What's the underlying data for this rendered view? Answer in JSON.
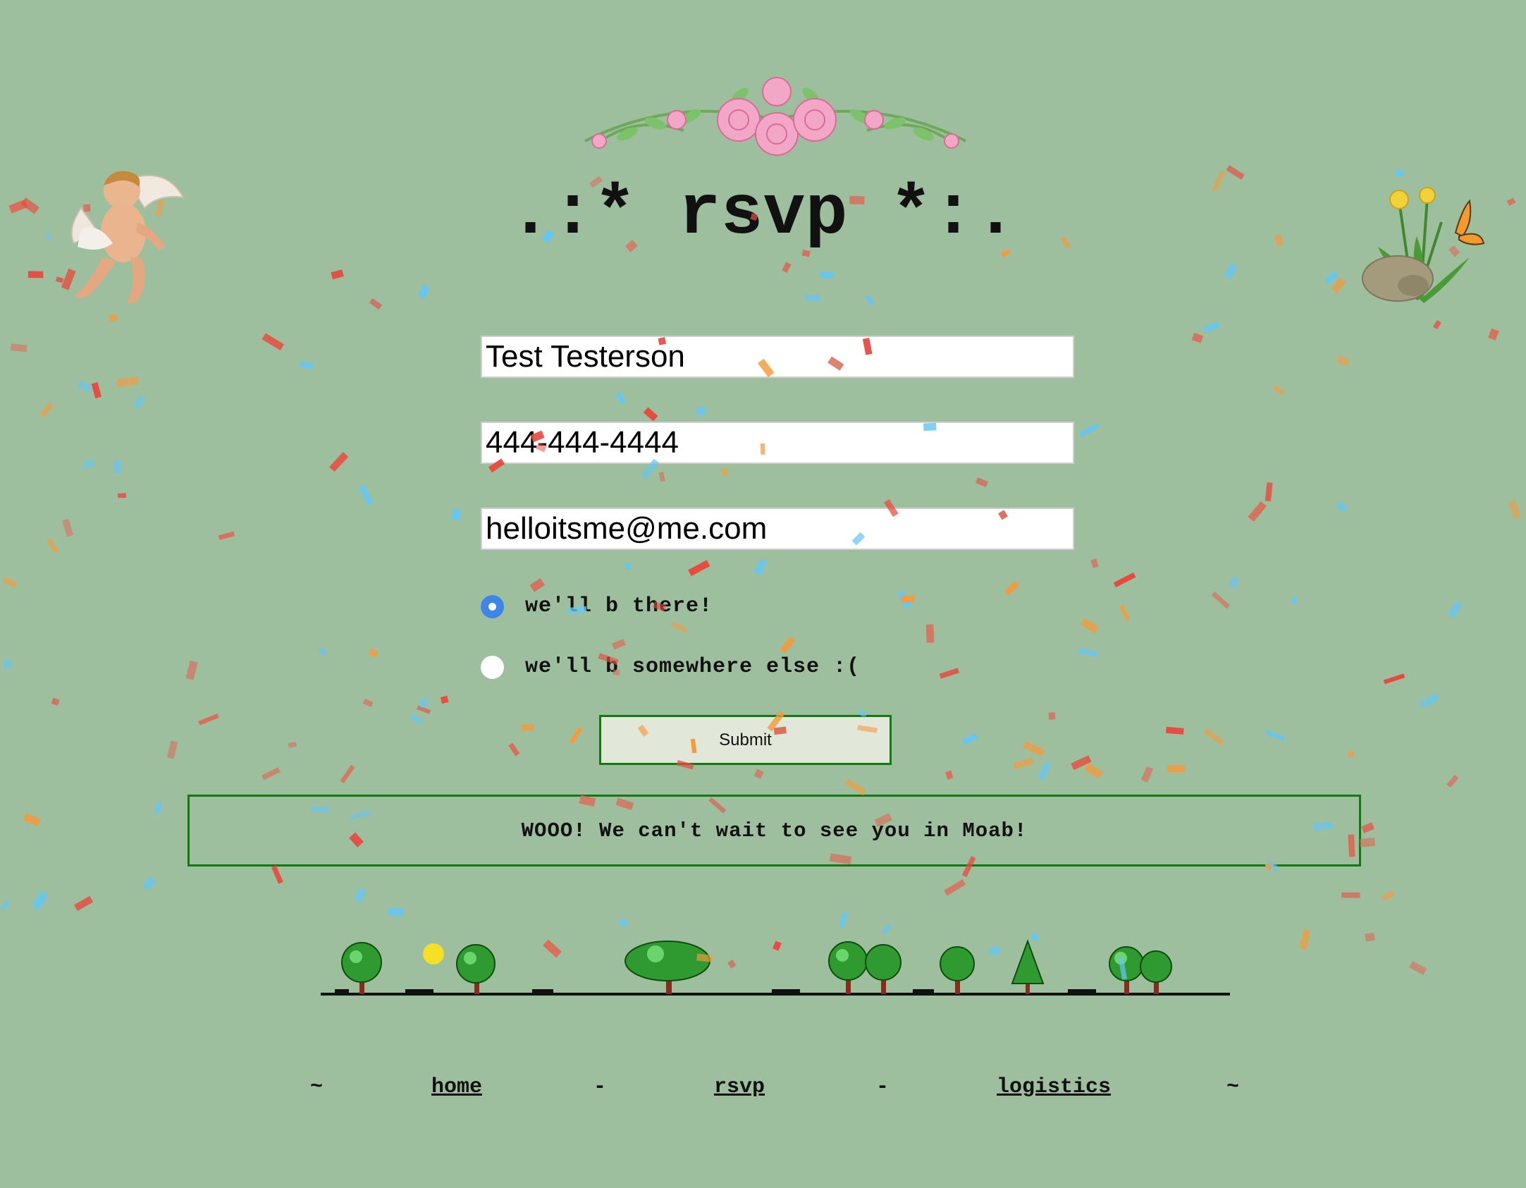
{
  "page": {
    "title": ".:* rsvp *:.",
    "background_color": "#9ebf9e",
    "accent_color": "#107a10"
  },
  "form": {
    "name_value": "Test Testerson",
    "phone_value": "444-444-4444",
    "email_value": "helloitsme@me.com",
    "attendance_options": [
      {
        "label": "we'll b there!",
        "selected": true
      },
      {
        "label": "we'll b somewhere else :(",
        "selected": false
      }
    ],
    "submit_label": "Submit"
  },
  "confirmation": {
    "message": "WOOO! We can't wait to see you in Moab!"
  },
  "footer": {
    "left_tilde": "~",
    "separator_1": "-",
    "separator_2": "-",
    "right_tilde": "~",
    "links": [
      {
        "label": "home"
      },
      {
        "label": "rsvp"
      },
      {
        "label": "logistics"
      }
    ]
  },
  "decorations": {
    "top_garland": "pink-roses-garland-icon",
    "left_corner": "cherub-icon",
    "right_corner": "dandelion-butterfly-rock-icon",
    "bottom_strip": "pixel-trees-strip-icon",
    "confetti_colors": [
      "#e84a3f",
      "#f59a3b",
      "#66c6f2",
      "#d96e5a"
    ]
  }
}
